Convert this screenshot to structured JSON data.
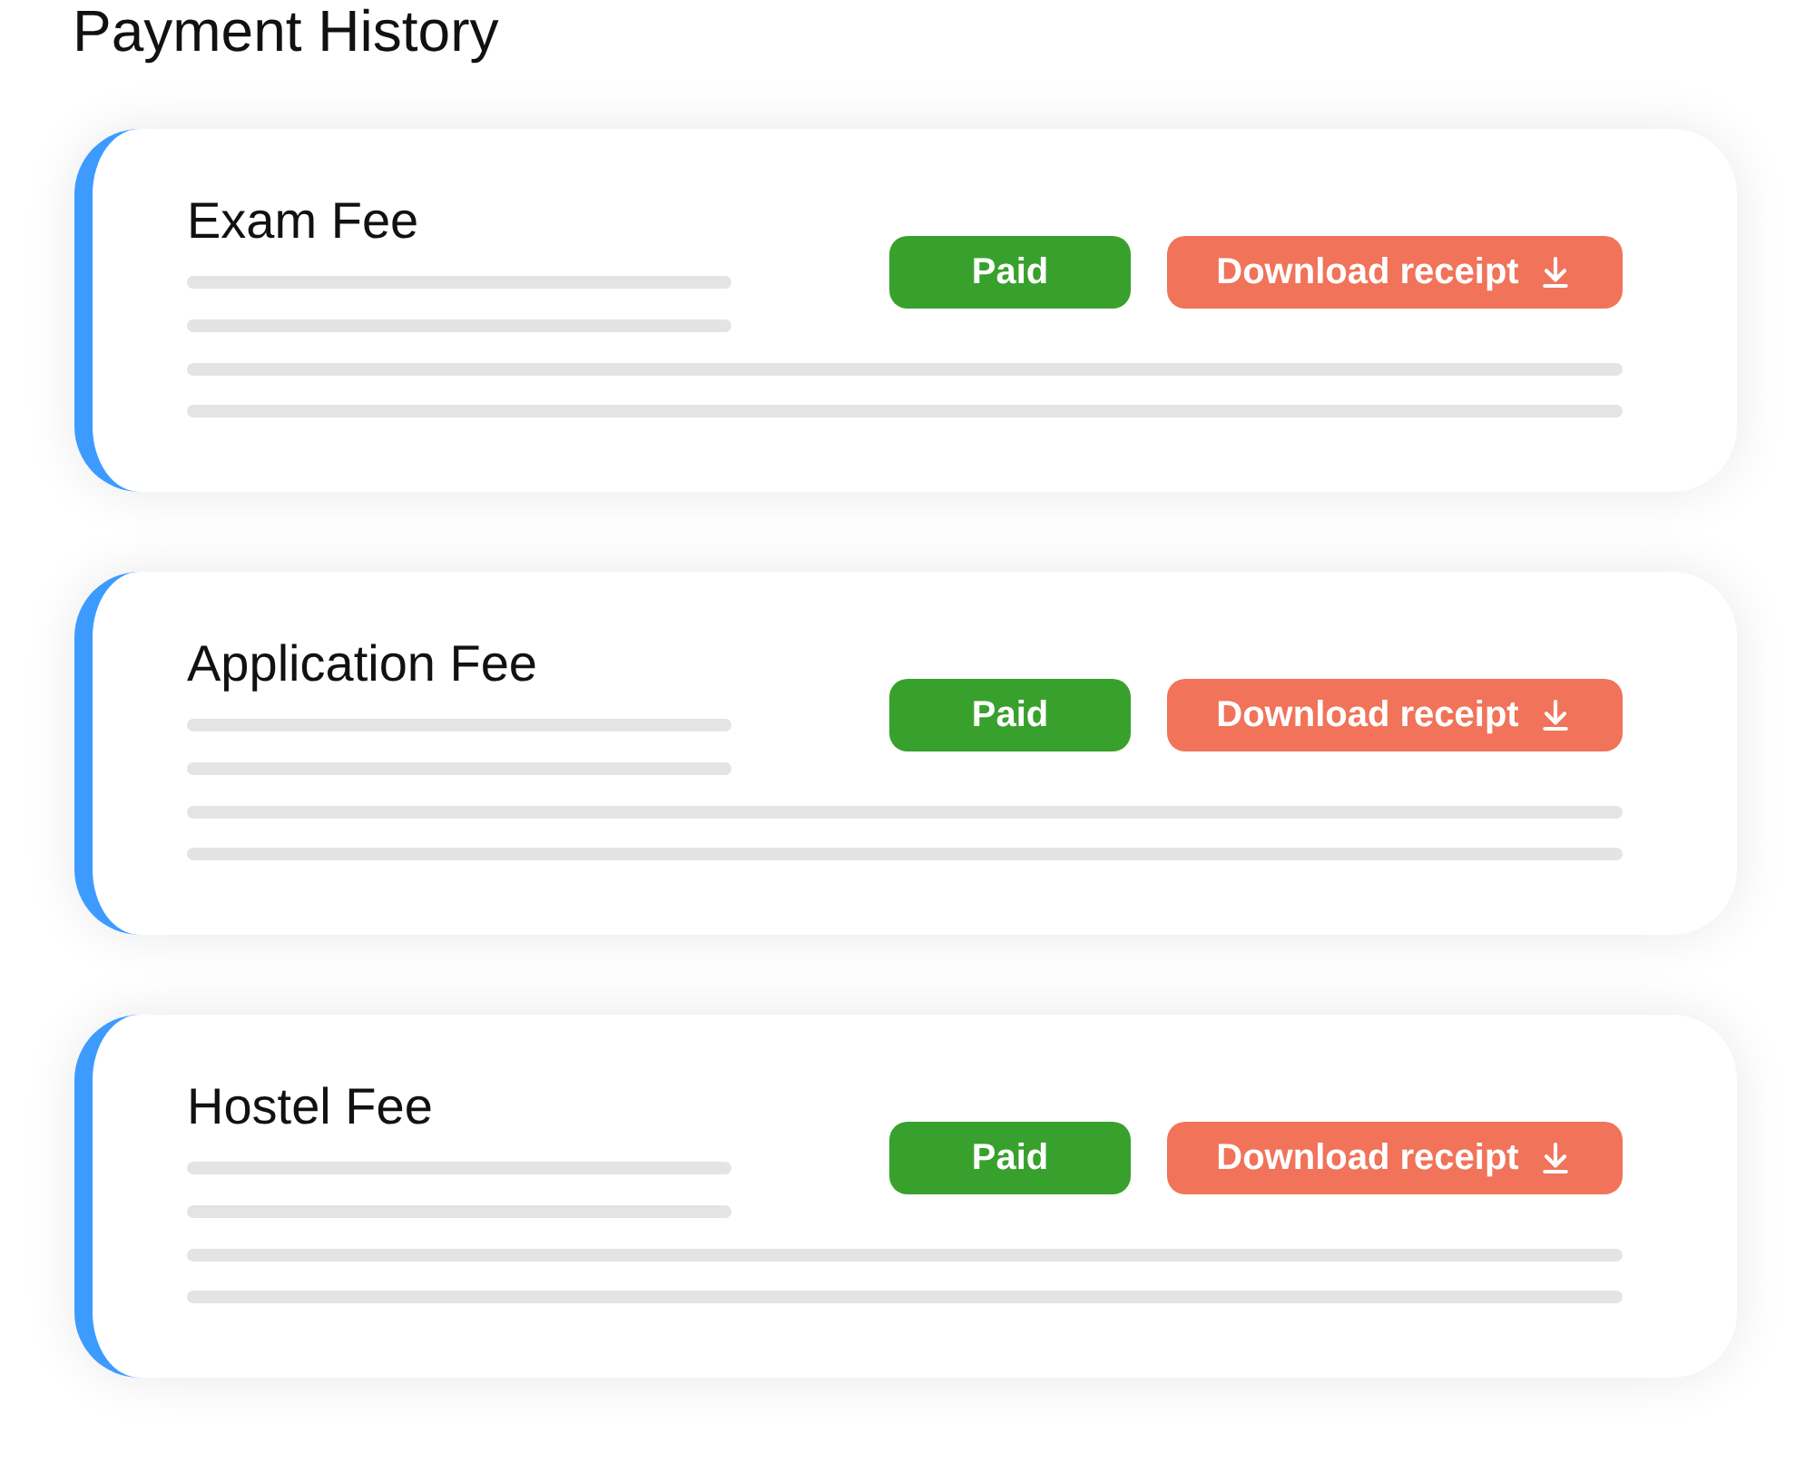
{
  "title": "Payment History",
  "payments": [
    {
      "name": "Exam Fee",
      "status": "Paid",
      "action": "Download receipt"
    },
    {
      "name": "Application Fee",
      "status": "Paid",
      "action": "Download receipt"
    },
    {
      "name": "Hostel Fee",
      "status": "Paid",
      "action": "Download receipt"
    }
  ]
}
